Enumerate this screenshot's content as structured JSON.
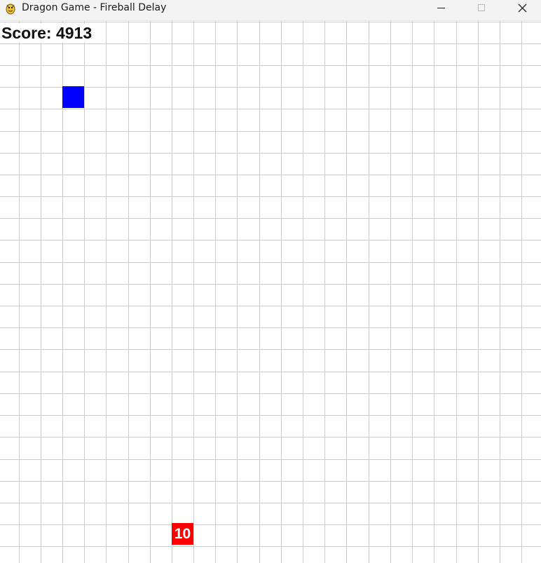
{
  "window": {
    "title": "Dragon Game - Fireball Delay",
    "app_icon": "pygame-snake-icon"
  },
  "hud": {
    "score_label": "Score: 4913"
  },
  "game": {
    "grid_color": "#cccccc",
    "background_color": "#ffffff",
    "player": {
      "color": "#0000ff"
    },
    "fireball": {
      "color": "#ff0000",
      "delay_label": "10"
    }
  },
  "colors": {
    "titlebar": "#f3f3f3",
    "text": "#111111"
  }
}
